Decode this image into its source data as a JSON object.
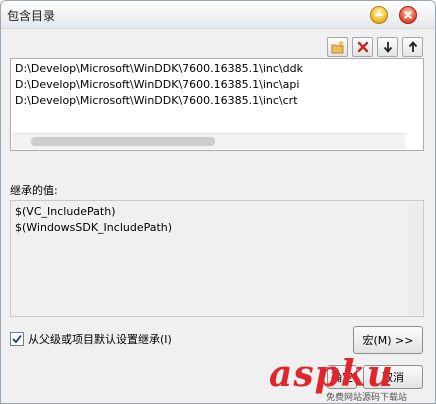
{
  "window": {
    "title": "包含目录"
  },
  "toolbar": {
    "buttons": [
      {
        "name": "new-folder-icon"
      },
      {
        "name": "delete-icon"
      },
      {
        "name": "move-down-icon"
      },
      {
        "name": "move-up-icon"
      }
    ]
  },
  "directories": {
    "items": [
      "D:\\Develop\\Microsoft\\WinDDK\\7600.16385.1\\inc\\ddk",
      "D:\\Develop\\Microsoft\\WinDDK\\7600.16385.1\\inc\\api",
      "D:\\Develop\\Microsoft\\WinDDK\\7600.16385.1\\inc\\crt"
    ]
  },
  "inherited": {
    "label": "继承的值:",
    "values": [
      "$(VC_IncludePath)",
      "$(WindowsSDK_IncludePath)"
    ]
  },
  "inherit_checkbox": {
    "label": "从父级或项目默认设置继承(I)",
    "checked": true
  },
  "buttons": {
    "macro": "宏(M) >>",
    "ok": "确定",
    "cancel": "取消"
  },
  "watermark": {
    "main": "aspku",
    "sub": "免费网站源码下载站"
  },
  "colors": {
    "delete": "#c8261e",
    "watermark": "#e0262c"
  }
}
